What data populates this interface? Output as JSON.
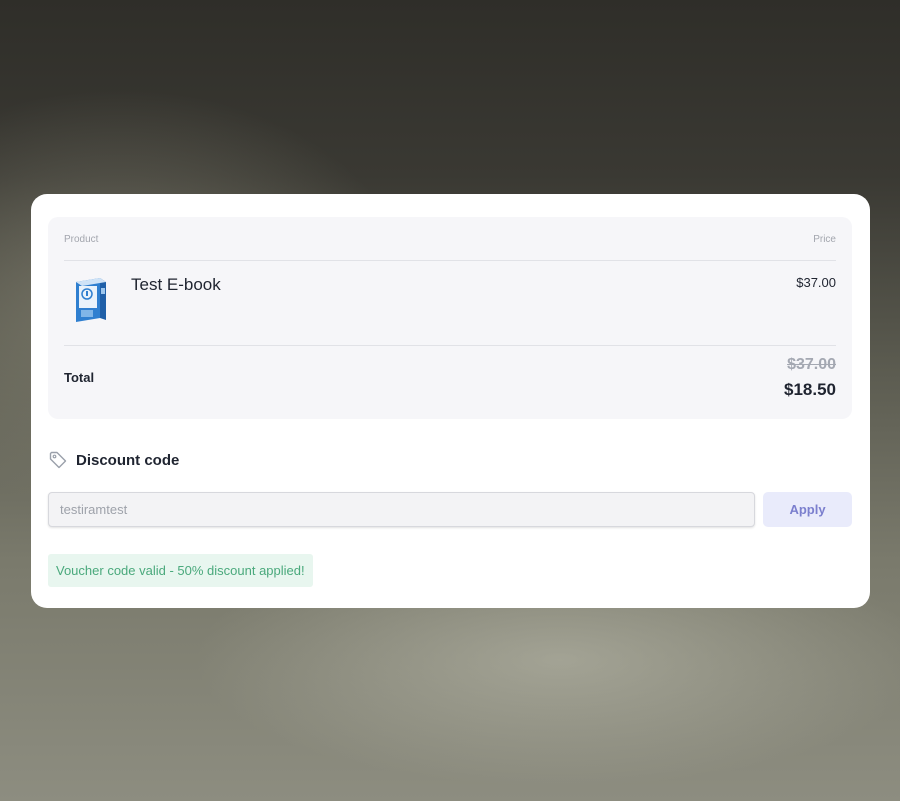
{
  "summary": {
    "col_product": "Product",
    "col_price": "Price",
    "item": {
      "name": "Test E-book",
      "price": "$37.00",
      "image": "ebook-box-icon"
    },
    "total_label": "Total",
    "original_total": "$37.00",
    "discounted_total": "$18.50"
  },
  "discount": {
    "title": "Discount code",
    "icon": "tag-icon",
    "code_value": "testiramtest",
    "apply_label": "Apply",
    "message": "Voucher code valid - 50% discount applied!"
  },
  "colors": {
    "card": "#ffffff",
    "summary_bg": "#f6f6f9",
    "apply_bg": "#e9ebfb",
    "apply_text": "#7b7fce",
    "success_bg": "#e8f6ef",
    "success_text": "#4aa97c"
  }
}
